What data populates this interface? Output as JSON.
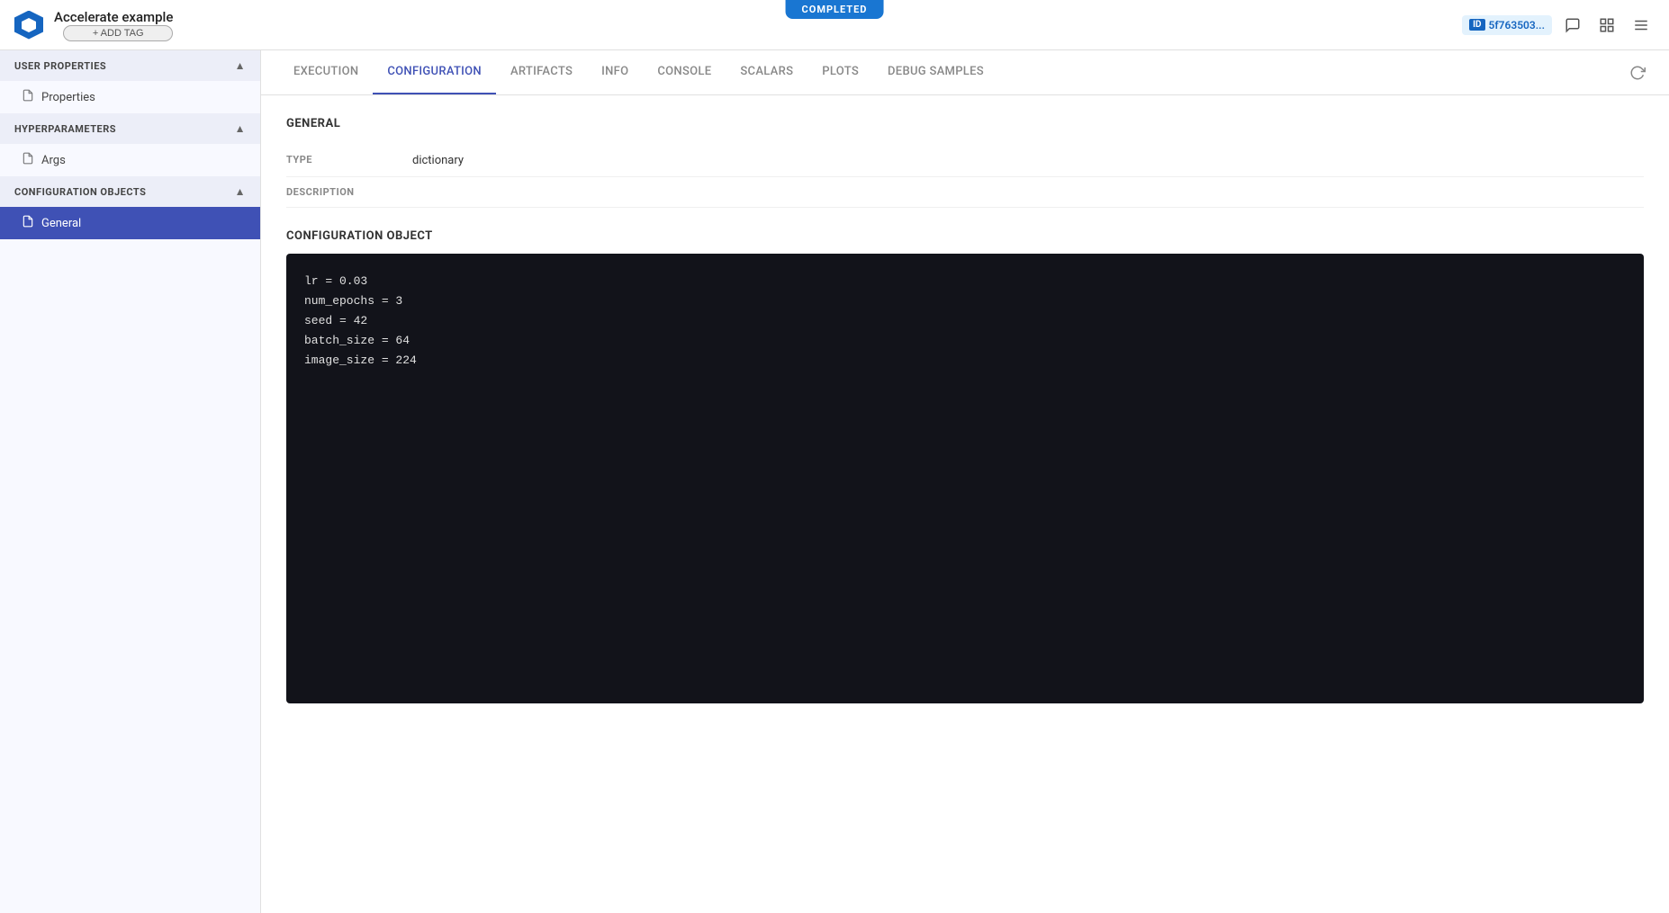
{
  "topbar": {
    "app_name": "Accelerate example",
    "add_tag_label": "+ ADD TAG",
    "completed_badge": "COMPLETED",
    "id_label": "ID",
    "id_value": "5f763503...",
    "icons": {
      "comment": "💬",
      "layout": "⊞",
      "menu": "☰"
    }
  },
  "sidebar": {
    "sections": [
      {
        "id": "user-properties",
        "label": "USER PROPERTIES",
        "expanded": true,
        "items": [
          {
            "id": "properties",
            "label": "Properties",
            "icon": "📄",
            "active": false
          }
        ]
      },
      {
        "id": "hyperparameters",
        "label": "HYPERPARAMETERS",
        "expanded": true,
        "items": [
          {
            "id": "args",
            "label": "Args",
            "icon": "📄",
            "active": false
          }
        ]
      },
      {
        "id": "configuration-objects",
        "label": "CONFIGURATION OBJECTS",
        "expanded": true,
        "items": [
          {
            "id": "general",
            "label": "General",
            "icon": "📄",
            "active": true
          }
        ]
      }
    ]
  },
  "tabs": [
    {
      "id": "execution",
      "label": "EXECUTION",
      "active": false
    },
    {
      "id": "configuration",
      "label": "CONFIGURATION",
      "active": true
    },
    {
      "id": "artifacts",
      "label": "ARTIFACTS",
      "active": false
    },
    {
      "id": "info",
      "label": "INFO",
      "active": false
    },
    {
      "id": "console",
      "label": "CONSOLE",
      "active": false
    },
    {
      "id": "scalars",
      "label": "SCALARS",
      "active": false
    },
    {
      "id": "plots",
      "label": "PLOTS",
      "active": false
    },
    {
      "id": "debug-samples",
      "label": "DEBUG SAMPLES",
      "active": false
    }
  ],
  "general_section": {
    "title": "GENERAL",
    "fields": [
      {
        "label": "TYPE",
        "value": "dictionary"
      },
      {
        "label": "DESCRIPTION",
        "value": ""
      }
    ]
  },
  "config_object": {
    "title": "CONFIGURATION OBJECT",
    "code_lines": [
      "lr = 0.03",
      "num_epochs = 3",
      "seed = 42",
      "batch_size = 64",
      "image_size = 224"
    ]
  }
}
